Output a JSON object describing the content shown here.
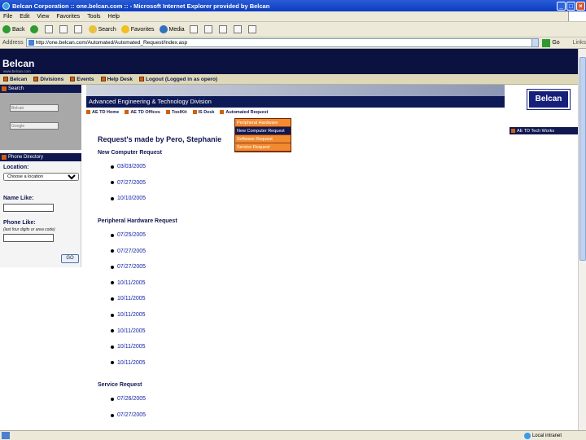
{
  "window": {
    "title": "Belcan Corporation :: one.belcan.com :: - Microsoft Internet Explorer provided by Belcan"
  },
  "menu": [
    "File",
    "Edit",
    "View",
    "Favorites",
    "Tools",
    "Help"
  ],
  "toolbar": {
    "back": "Back",
    "search": "Search",
    "favorites": "Favorites",
    "media": "Media"
  },
  "address": {
    "label": "Address",
    "url": "http://one.belcan.com/Automated/Automated_Request/Index.asp",
    "go": "Go",
    "links": "Links"
  },
  "site": {
    "logo": "Belcan",
    "logo_sub": "www.belcan.com",
    "nav": [
      "Belcan",
      "Divisions",
      "Events",
      "Help Desk",
      "Logout (Logged in as opero)"
    ],
    "search_head": "Search",
    "search_placeholder1": "Belcan",
    "search_placeholder2": "Google",
    "phone_head": "Phone Directory",
    "location_label": "Location:",
    "location_value": "Choose a location",
    "name_label": "Name Like:",
    "phone_label": "Phone Like:",
    "phone_hint": "(last four digits or area code)",
    "go_button": "GO",
    "division_title": "Advanced Engineering & Technology Division",
    "subnav": [
      "AE TD Home",
      "AE TD Offices",
      "ToolKit",
      "IS Desk",
      "Automated Request"
    ],
    "dropdown": [
      "Peripheral Hardware",
      "New Computer Request",
      "Software Request",
      "Service Request"
    ],
    "belcan_button": "Belcan",
    "right_link": "AE TD Tech Works"
  },
  "main": {
    "heading": "Request's made by Pero, Stephanie",
    "sections": [
      {
        "title": "New Computer Request",
        "dates": [
          "03/03/2005",
          "07/27/2005",
          "10/10/2005"
        ]
      },
      {
        "title": "Peripheral Hardware Request",
        "dates": [
          "07/25/2005",
          "07/27/2005",
          "07/27/2005",
          "10/11/2005",
          "10/11/2005",
          "10/11/2005",
          "10/11/2005",
          "10/11/2005",
          "10/11/2005"
        ]
      },
      {
        "title": "Service Request",
        "dates": [
          "07/26/2005",
          "07/27/2005"
        ]
      }
    ]
  },
  "status": {
    "zone": "Local intranet"
  }
}
